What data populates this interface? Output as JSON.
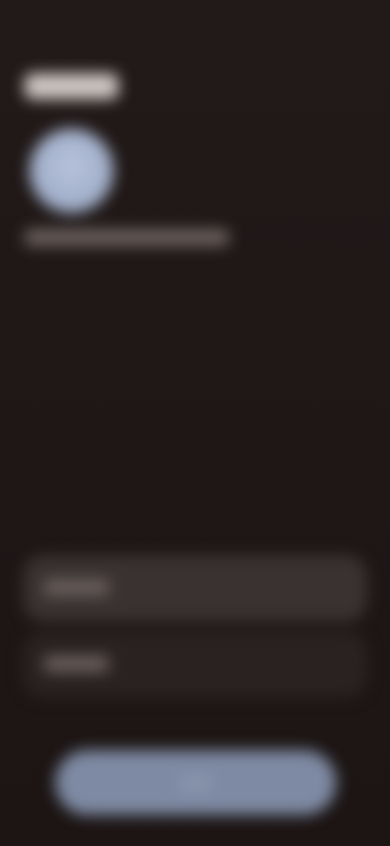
{
  "status_bar": {
    "time": "",
    "indicators": ""
  },
  "header": {
    "title": ""
  },
  "profile": {
    "avatar_initial": "",
    "account_text": ""
  },
  "options": [
    {
      "label": ""
    },
    {
      "label": ""
    }
  ],
  "primary_action": {
    "label": ""
  },
  "colors": {
    "background": "#211918",
    "accent": "#7e8aa3",
    "avatar": "#a9b5ce",
    "option_selected": "#3a3231",
    "option_default": "#2a2221"
  },
  "icons": {
    "avatar": "user-avatar-icon"
  }
}
